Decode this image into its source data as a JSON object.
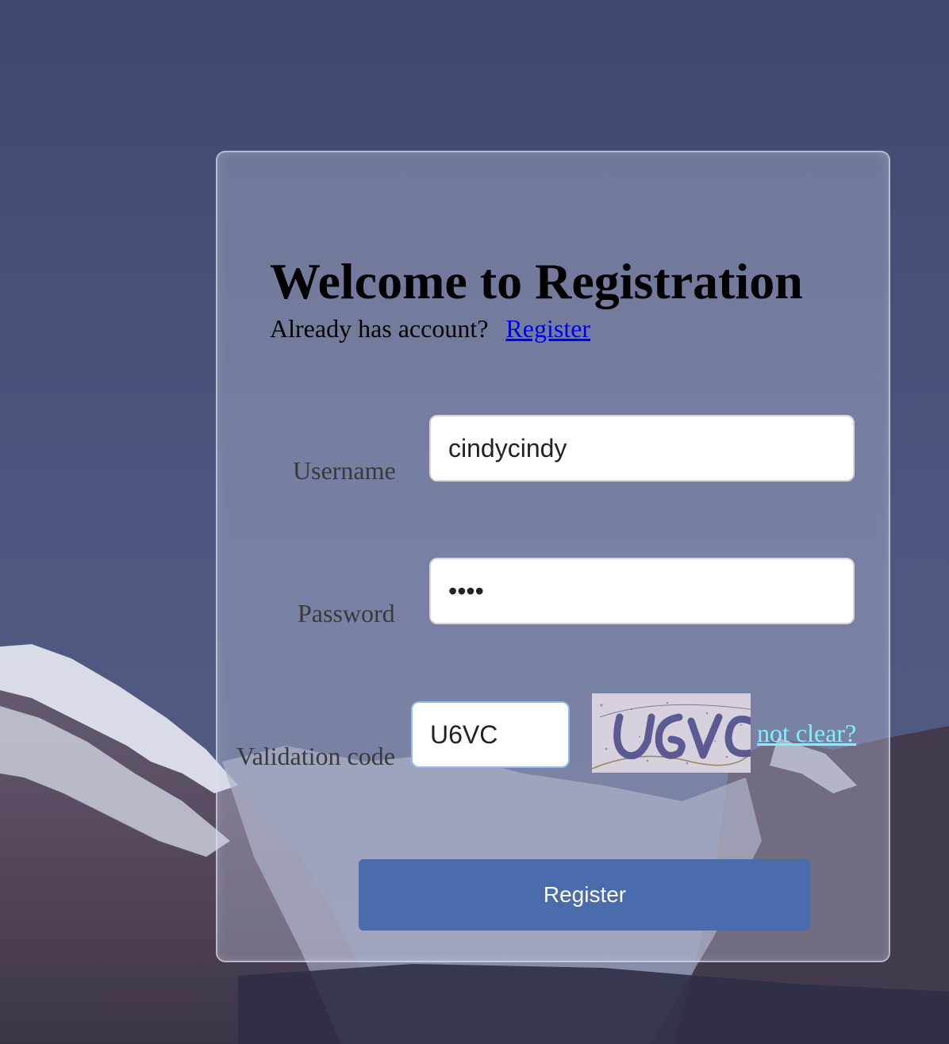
{
  "page": {
    "title": "Welcome to Registration",
    "subtitle_text": "Already has account?",
    "subtitle_link": "Register"
  },
  "form": {
    "username_label": "Username",
    "username_value": "cindycindy",
    "password_label": "Password",
    "password_value": "••••",
    "validation_label": "Validation code",
    "validation_value": "U6VC",
    "captcha_text": "U6VC",
    "refresh_link": "not clear?",
    "submit_label": "Register"
  },
  "colors": {
    "submit_button": "#4a6cad",
    "link": "#0000ee",
    "refresh_link": "#7ff0ff"
  }
}
